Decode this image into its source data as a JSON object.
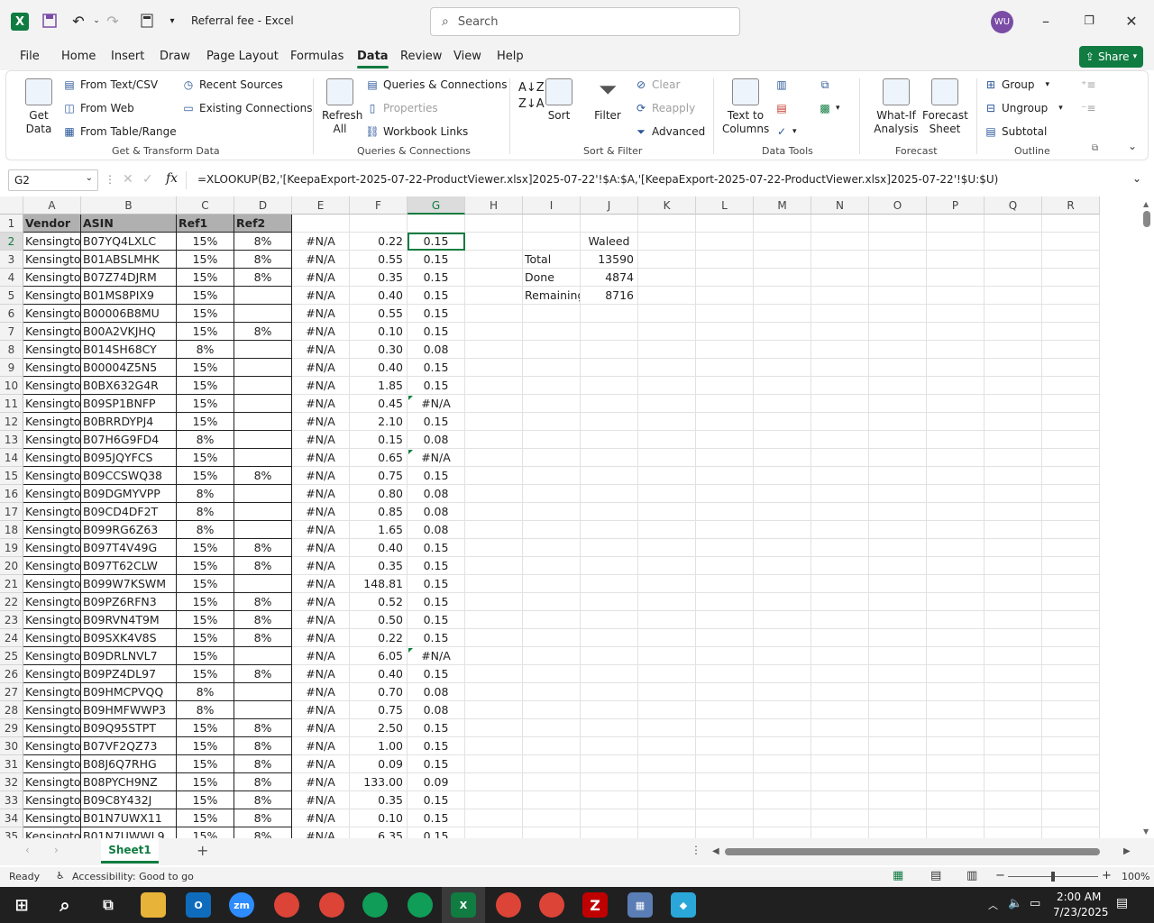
{
  "window": {
    "title": "Referral fee  -  Excel",
    "search_placeholder": "Search",
    "avatar": "WU",
    "share": "Share"
  },
  "menu": [
    "File",
    "Home",
    "Insert",
    "Draw",
    "Page Layout",
    "Formulas",
    "Data",
    "Review",
    "View",
    "Help"
  ],
  "ribbon": {
    "get_data": "Get Data",
    "from_text": "From Text/CSV",
    "from_web": "From Web",
    "from_table": "From Table/Range",
    "recent": "Recent Sources",
    "existing": "Existing Connections",
    "refresh": "Refresh All",
    "queries": "Queries & Connections",
    "properties": "Properties",
    "workbook_links": "Workbook Links",
    "sort": "Sort",
    "filter": "Filter",
    "clear": "Clear",
    "reapply": "Reapply",
    "advanced": "Advanced",
    "text_to_columns": "Text to Columns",
    "what_if": "What-If Analysis",
    "forecast_sheet": "Forecast Sheet",
    "group": "Group",
    "ungroup": "Ungroup",
    "subtotal": "Subtotal",
    "groups": [
      "Get & Transform Data",
      "Queries & Connections",
      "Sort & Filter",
      "Data Tools",
      "Forecast",
      "Outline"
    ]
  },
  "formula_bar": {
    "name_box": "G2",
    "formula": "=XLOOKUP(B2,'[KeepaExport-2025-07-22-ProductViewer.xlsx]2025-07-22'!$A:$A,'[KeepaExport-2025-07-22-ProductViewer.xlsx]2025-07-22'!$U:$U)"
  },
  "columns": [
    "A",
    "B",
    "C",
    "D",
    "E",
    "F",
    "G",
    "H",
    "I",
    "J",
    "K",
    "L",
    "M",
    "N",
    "O",
    "P",
    "Q",
    "R"
  ],
  "header_row": [
    "Vendor",
    "ASIN",
    "Ref1",
    "Ref2"
  ],
  "rows": [
    [
      "Kensington",
      "B07YQ4LXLC",
      "15%",
      "8%",
      "#N/A",
      "0.22",
      "0.15"
    ],
    [
      "Kensington",
      "B01ABSLMHK",
      "15%",
      "8%",
      "#N/A",
      "0.55",
      "0.15"
    ],
    [
      "Kensington",
      "B07Z74DJRM",
      "15%",
      "8%",
      "#N/A",
      "0.35",
      "0.15"
    ],
    [
      "Kensington",
      "B01MS8PIX9",
      "15%",
      "",
      "#N/A",
      "0.40",
      "0.15"
    ],
    [
      "Kensington",
      "B00006B8MU",
      "15%",
      "",
      "#N/A",
      "0.55",
      "0.15"
    ],
    [
      "Kensington",
      "B00A2VKJHQ",
      "15%",
      "8%",
      "#N/A",
      "0.10",
      "0.15"
    ],
    [
      "Kensington",
      "B014SH68CY",
      "8%",
      "",
      "#N/A",
      "0.30",
      "0.08"
    ],
    [
      "Kensington",
      "B00004Z5N5",
      "15%",
      "",
      "#N/A",
      "0.40",
      "0.15"
    ],
    [
      "Kensington",
      "B0BX632G4R",
      "15%",
      "",
      "#N/A",
      "1.85",
      "0.15"
    ],
    [
      "Kensington",
      "B09SP1BNFP",
      "15%",
      "",
      "#N/A",
      "0.45",
      "#N/A"
    ],
    [
      "Kensington",
      "B0BRRDYPJ4",
      "15%",
      "",
      "#N/A",
      "2.10",
      "0.15"
    ],
    [
      "Kensington",
      "B07H6G9FD4",
      "8%",
      "",
      "#N/A",
      "0.15",
      "0.08"
    ],
    [
      "Kensington",
      "B095JQYFCS",
      "15%",
      "",
      "#N/A",
      "0.65",
      "#N/A"
    ],
    [
      "Kensington",
      "B09CCSWQ38",
      "15%",
      "8%",
      "#N/A",
      "0.75",
      "0.15"
    ],
    [
      "Kensington",
      "B09DGMYVPP",
      "8%",
      "",
      "#N/A",
      "0.80",
      "0.08"
    ],
    [
      "Kensington",
      "B09CD4DF2T",
      "8%",
      "",
      "#N/A",
      "0.85",
      "0.08"
    ],
    [
      "Kensington",
      "B099RG6Z63",
      "8%",
      "",
      "#N/A",
      "1.65",
      "0.08"
    ],
    [
      "Kensington",
      "B097T4V49G",
      "15%",
      "8%",
      "#N/A",
      "0.40",
      "0.15"
    ],
    [
      "Kensington",
      "B097T62CLW",
      "15%",
      "8%",
      "#N/A",
      "0.35",
      "0.15"
    ],
    [
      "Kensington",
      "B099W7KSWM",
      "15%",
      "",
      "#N/A",
      "148.81",
      "0.15"
    ],
    [
      "Kensington",
      "B09PZ6RFN3",
      "15%",
      "8%",
      "#N/A",
      "0.52",
      "0.15"
    ],
    [
      "Kensington",
      "B09RVN4T9M",
      "15%",
      "8%",
      "#N/A",
      "0.50",
      "0.15"
    ],
    [
      "Kensington",
      "B09SXK4V8S",
      "15%",
      "8%",
      "#N/A",
      "0.22",
      "0.15"
    ],
    [
      "Kensington",
      "B09DRLNVL7",
      "15%",
      "",
      "#N/A",
      "6.05",
      "#N/A"
    ],
    [
      "Kensington",
      "B09PZ4DL97",
      "15%",
      "8%",
      "#N/A",
      "0.40",
      "0.15"
    ],
    [
      "Kensington",
      "B09HMCPVQQ",
      "8%",
      "",
      "#N/A",
      "0.70",
      "0.08"
    ],
    [
      "Kensington",
      "B09HMFWWP3",
      "8%",
      "",
      "#N/A",
      "0.75",
      "0.08"
    ],
    [
      "Kensington",
      "B09Q95STPT",
      "15%",
      "8%",
      "#N/A",
      "2.50",
      "0.15"
    ],
    [
      "Kensington",
      "B07VF2QZ73",
      "15%",
      "8%",
      "#N/A",
      "1.00",
      "0.15"
    ],
    [
      "Kensington",
      "B08J6Q7RHG",
      "15%",
      "8%",
      "#N/A",
      "0.09",
      "0.15"
    ],
    [
      "Kensington",
      "B08PYCH9NZ",
      "15%",
      "8%",
      "#N/A",
      "133.00",
      "0.09"
    ],
    [
      "Kensington",
      "B09C8Y432J",
      "15%",
      "8%",
      "#N/A",
      "0.35",
      "0.15"
    ],
    [
      "Kensington",
      "B01N7UWX11",
      "15%",
      "8%",
      "#N/A",
      "0.10",
      "0.15"
    ],
    [
      "Kensington",
      "B01N7UWWL9",
      "15%",
      "8%",
      "#N/A",
      "6.35",
      "0.15"
    ]
  ],
  "summary": {
    "name": "Waleed",
    "total_label": "Total",
    "total": "13590",
    "done_label": "Done",
    "done": "4874",
    "remaining_label": "Remaining",
    "remaining": "8716"
  },
  "sheet_tab": "Sheet1",
  "status": {
    "ready": "Ready",
    "accessibility": "Accessibility: Good to go",
    "zoom": "100%"
  },
  "taskbar": {
    "time": "2:00 AM",
    "date": "7/23/2025"
  }
}
